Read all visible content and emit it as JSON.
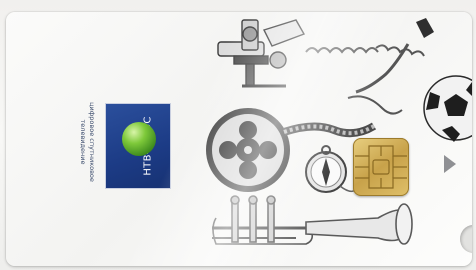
{
  "card": {
    "brand_logo_text": "НТВ-ПЛЮС",
    "caption_line1": "цифровое спутниковое",
    "caption_line2": "телевидение"
  },
  "colors": {
    "logo_blue": "#1c3b85",
    "logo_green": "#6fbf2f",
    "chip_gold": "#d2ae55"
  },
  "icons": [
    "film-reel-icon",
    "microscope-icon",
    "telephone-cord-icon",
    "soccer-ball-icon",
    "compass-icon",
    "trumpet-icon",
    "smart-chip-icon",
    "arrow-triangle-icon"
  ]
}
